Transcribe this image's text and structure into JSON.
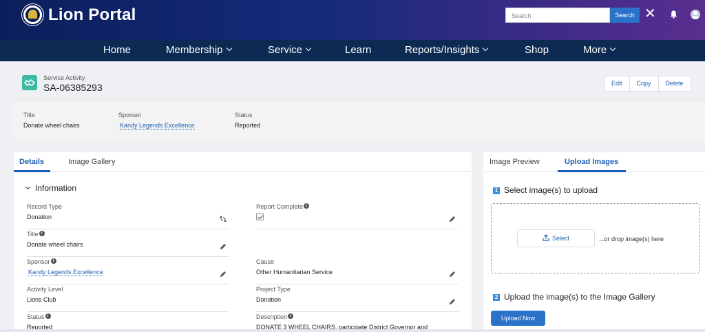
{
  "header": {
    "brand": "Lion Portal",
    "search_placeholder": "Search",
    "search_button": "Search"
  },
  "nav": {
    "items": [
      {
        "label": "Home",
        "dropdown": false
      },
      {
        "label": "Membership",
        "dropdown": true
      },
      {
        "label": "Service",
        "dropdown": true
      },
      {
        "label": "Learn",
        "dropdown": false
      },
      {
        "label": "Reports/Insights",
        "dropdown": true
      },
      {
        "label": "Shop",
        "dropdown": false
      },
      {
        "label": "More",
        "dropdown": true
      }
    ]
  },
  "record": {
    "type": "Service Activity",
    "name": "SA-06385293",
    "actions": [
      "Edit",
      "Copy",
      "Delete"
    ],
    "icon": "handshake-icon",
    "icon_color": "#3fb9a3"
  },
  "highlights": {
    "title_label": "Title",
    "title_value": "Donate wheel chairs",
    "sponsor_label": "Sponsor",
    "sponsor_value": "Kandy Legends Excellence",
    "status_label": "Status",
    "status_value": "Reported"
  },
  "detail_tabs": {
    "tabs": [
      "Details",
      "Image Gallery"
    ],
    "active": "Details"
  },
  "information": {
    "section_title": "Information",
    "fields": {
      "record_type": {
        "label": "Record Type",
        "value": "Donation"
      },
      "report_complete": {
        "label": "Report Complete",
        "value": "checked"
      },
      "title": {
        "label": "Title",
        "value": "Donate wheel chairs"
      },
      "sponsor": {
        "label": "Sponsor",
        "value": "Kandy Legends Excellence"
      },
      "cause": {
        "label": "Cause",
        "value": "Other Humanitarian Service"
      },
      "activity_level": {
        "label": "Activity Level",
        "value": "Lions Club"
      },
      "project_type": {
        "label": "Project Type",
        "value": "Donation"
      },
      "status": {
        "label": "Status",
        "value": "Reported"
      },
      "description": {
        "label": "Description",
        "value": "DONATE 3 WHEEL CHAIRS. participate District Governor and"
      }
    }
  },
  "upload": {
    "tabs": [
      "Image Preview",
      "Upload Images"
    ],
    "active": "Upload Images",
    "step1_num": "1",
    "step1": "Select image(s) to upload",
    "select_button": "Select",
    "drop_text": "...or drop image(s) here",
    "step2_num": "2",
    "step2": "Upload the image(s) to the Image Gallery",
    "upload_button": "Upload Now"
  },
  "colors": {
    "accent": "#1a5fb4",
    "button_blue": "#2b72c9",
    "nav_bg": "#0d2b52"
  }
}
